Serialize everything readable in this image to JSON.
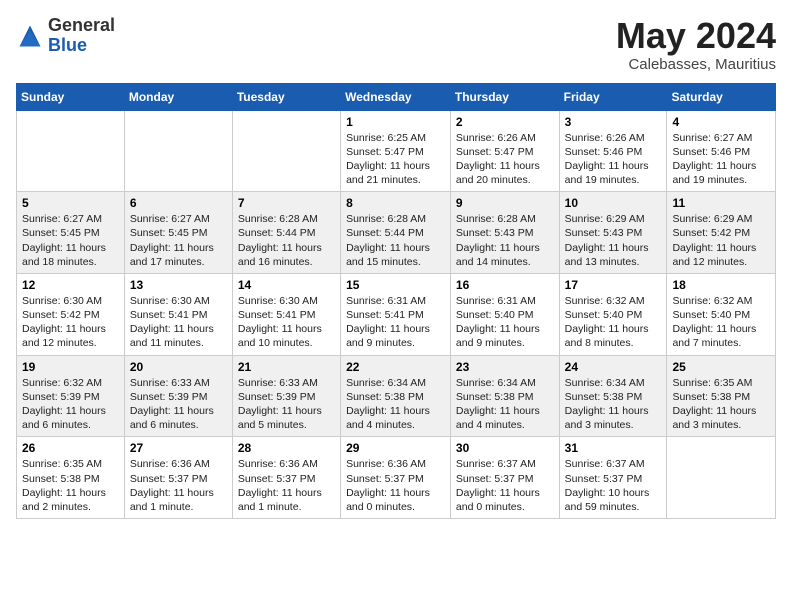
{
  "header": {
    "logo_line1": "General",
    "logo_line2": "Blue",
    "title": "May 2024",
    "subtitle": "Calebasses, Mauritius"
  },
  "days_of_week": [
    "Sunday",
    "Monday",
    "Tuesday",
    "Wednesday",
    "Thursday",
    "Friday",
    "Saturday"
  ],
  "weeks": [
    [
      {
        "day": "",
        "info": ""
      },
      {
        "day": "",
        "info": ""
      },
      {
        "day": "",
        "info": ""
      },
      {
        "day": "1",
        "info": "Sunrise: 6:25 AM\nSunset: 5:47 PM\nDaylight: 11 hours\nand 21 minutes."
      },
      {
        "day": "2",
        "info": "Sunrise: 6:26 AM\nSunset: 5:47 PM\nDaylight: 11 hours\nand 20 minutes."
      },
      {
        "day": "3",
        "info": "Sunrise: 6:26 AM\nSunset: 5:46 PM\nDaylight: 11 hours\nand 19 minutes."
      },
      {
        "day": "4",
        "info": "Sunrise: 6:27 AM\nSunset: 5:46 PM\nDaylight: 11 hours\nand 19 minutes."
      }
    ],
    [
      {
        "day": "5",
        "info": "Sunrise: 6:27 AM\nSunset: 5:45 PM\nDaylight: 11 hours\nand 18 minutes."
      },
      {
        "day": "6",
        "info": "Sunrise: 6:27 AM\nSunset: 5:45 PM\nDaylight: 11 hours\nand 17 minutes."
      },
      {
        "day": "7",
        "info": "Sunrise: 6:28 AM\nSunset: 5:44 PM\nDaylight: 11 hours\nand 16 minutes."
      },
      {
        "day": "8",
        "info": "Sunrise: 6:28 AM\nSunset: 5:44 PM\nDaylight: 11 hours\nand 15 minutes."
      },
      {
        "day": "9",
        "info": "Sunrise: 6:28 AM\nSunset: 5:43 PM\nDaylight: 11 hours\nand 14 minutes."
      },
      {
        "day": "10",
        "info": "Sunrise: 6:29 AM\nSunset: 5:43 PM\nDaylight: 11 hours\nand 13 minutes."
      },
      {
        "day": "11",
        "info": "Sunrise: 6:29 AM\nSunset: 5:42 PM\nDaylight: 11 hours\nand 12 minutes."
      }
    ],
    [
      {
        "day": "12",
        "info": "Sunrise: 6:30 AM\nSunset: 5:42 PM\nDaylight: 11 hours\nand 12 minutes."
      },
      {
        "day": "13",
        "info": "Sunrise: 6:30 AM\nSunset: 5:41 PM\nDaylight: 11 hours\nand 11 minutes."
      },
      {
        "day": "14",
        "info": "Sunrise: 6:30 AM\nSunset: 5:41 PM\nDaylight: 11 hours\nand 10 minutes."
      },
      {
        "day": "15",
        "info": "Sunrise: 6:31 AM\nSunset: 5:41 PM\nDaylight: 11 hours\nand 9 minutes."
      },
      {
        "day": "16",
        "info": "Sunrise: 6:31 AM\nSunset: 5:40 PM\nDaylight: 11 hours\nand 9 minutes."
      },
      {
        "day": "17",
        "info": "Sunrise: 6:32 AM\nSunset: 5:40 PM\nDaylight: 11 hours\nand 8 minutes."
      },
      {
        "day": "18",
        "info": "Sunrise: 6:32 AM\nSunset: 5:40 PM\nDaylight: 11 hours\nand 7 minutes."
      }
    ],
    [
      {
        "day": "19",
        "info": "Sunrise: 6:32 AM\nSunset: 5:39 PM\nDaylight: 11 hours\nand 6 minutes."
      },
      {
        "day": "20",
        "info": "Sunrise: 6:33 AM\nSunset: 5:39 PM\nDaylight: 11 hours\nand 6 minutes."
      },
      {
        "day": "21",
        "info": "Sunrise: 6:33 AM\nSunset: 5:39 PM\nDaylight: 11 hours\nand 5 minutes."
      },
      {
        "day": "22",
        "info": "Sunrise: 6:34 AM\nSunset: 5:38 PM\nDaylight: 11 hours\nand 4 minutes."
      },
      {
        "day": "23",
        "info": "Sunrise: 6:34 AM\nSunset: 5:38 PM\nDaylight: 11 hours\nand 4 minutes."
      },
      {
        "day": "24",
        "info": "Sunrise: 6:34 AM\nSunset: 5:38 PM\nDaylight: 11 hours\nand 3 minutes."
      },
      {
        "day": "25",
        "info": "Sunrise: 6:35 AM\nSunset: 5:38 PM\nDaylight: 11 hours\nand 3 minutes."
      }
    ],
    [
      {
        "day": "26",
        "info": "Sunrise: 6:35 AM\nSunset: 5:38 PM\nDaylight: 11 hours\nand 2 minutes."
      },
      {
        "day": "27",
        "info": "Sunrise: 6:36 AM\nSunset: 5:37 PM\nDaylight: 11 hours\nand 1 minute."
      },
      {
        "day": "28",
        "info": "Sunrise: 6:36 AM\nSunset: 5:37 PM\nDaylight: 11 hours\nand 1 minute."
      },
      {
        "day": "29",
        "info": "Sunrise: 6:36 AM\nSunset: 5:37 PM\nDaylight: 11 hours\nand 0 minutes."
      },
      {
        "day": "30",
        "info": "Sunrise: 6:37 AM\nSunset: 5:37 PM\nDaylight: 11 hours\nand 0 minutes."
      },
      {
        "day": "31",
        "info": "Sunrise: 6:37 AM\nSunset: 5:37 PM\nDaylight: 10 hours\nand 59 minutes."
      },
      {
        "day": "",
        "info": ""
      }
    ]
  ]
}
